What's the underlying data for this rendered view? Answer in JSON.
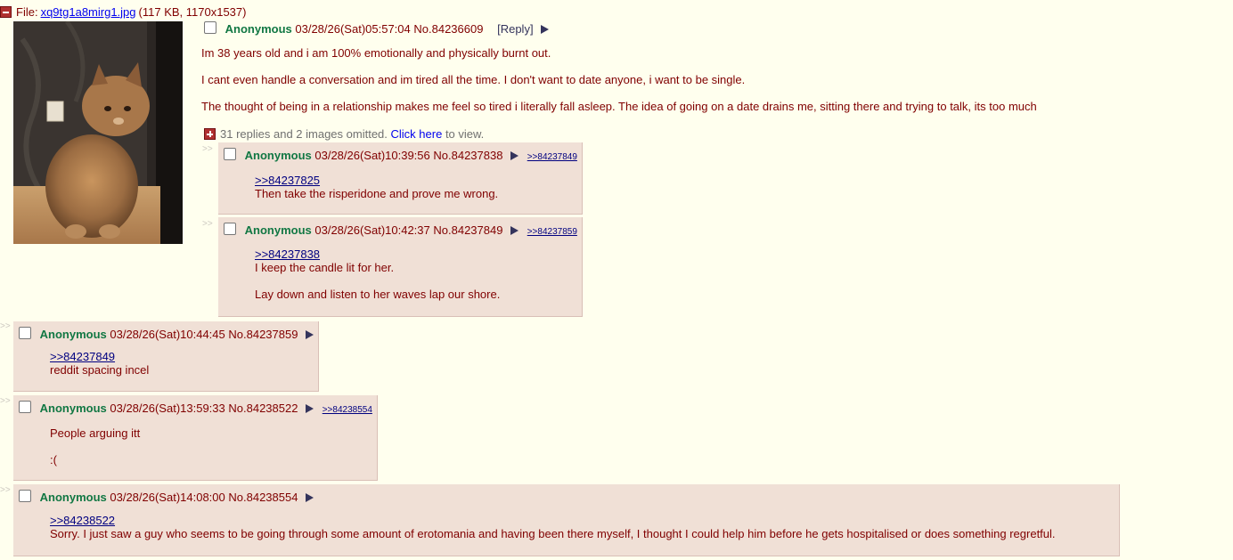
{
  "op": {
    "file_prefix": "File:",
    "filename": "xq9tg1a8mirg1.jpg",
    "file_meta": "(117 KB, 1170x1537)",
    "name": "Anonymous",
    "datetime": "03/28/26(Sat)05:57:04",
    "no": "No.84236609",
    "reply_label": "[Reply]",
    "paragraphs": [
      "Im 38 years old and i am 100% emotionally and physically burnt out.",
      "I cant even handle a conversation and im tired all the time. I don't want to date anyone, i want to be single.",
      "The thought of being in a relationship makes me feel so tired i literally fall asleep. The idea of going on a date drains me, sitting there and trying to talk, its too much"
    ]
  },
  "omitted": {
    "text": "31 replies and 2 images omitted.",
    "link": "Click here",
    "suffix": "to view."
  },
  "arrow_glyph": ">>",
  "replies": [
    {
      "name": "Anonymous",
      "datetime": "03/28/26(Sat)10:39:56",
      "no": "No.84237838",
      "backlink": ">>84237849",
      "quote": ">>84237825",
      "lines": [
        "Then take the risperidone and prove me wrong."
      ]
    },
    {
      "name": "Anonymous",
      "datetime": "03/28/26(Sat)10:42:37",
      "no": "No.84237849",
      "backlink": ">>84237859",
      "quote": ">>84237838",
      "lines": [
        "I keep the candle lit for her.",
        "Lay down and listen to her waves lap our shore."
      ]
    },
    {
      "name": "Anonymous",
      "datetime": "03/28/26(Sat)10:44:45",
      "no": "No.84237859",
      "backlink": "",
      "quote": ">>84237849",
      "lines": [
        "reddit spacing incel"
      ]
    },
    {
      "name": "Anonymous",
      "datetime": "03/28/26(Sat)13:59:33",
      "no": "No.84238522",
      "backlink": ">>84238554",
      "quote": "",
      "lines": [
        "People arguing itt",
        ":("
      ]
    },
    {
      "name": "Anonymous",
      "datetime": "03/28/26(Sat)14:08:00",
      "no": "No.84238554",
      "backlink": "",
      "quote": ">>84238522",
      "lines": [
        "Sorry. I just saw a guy who seems to be going through some amount of erotomania and having been there myself, I thought I could help him before he gets hospitalised or does something regretful."
      ]
    }
  ]
}
